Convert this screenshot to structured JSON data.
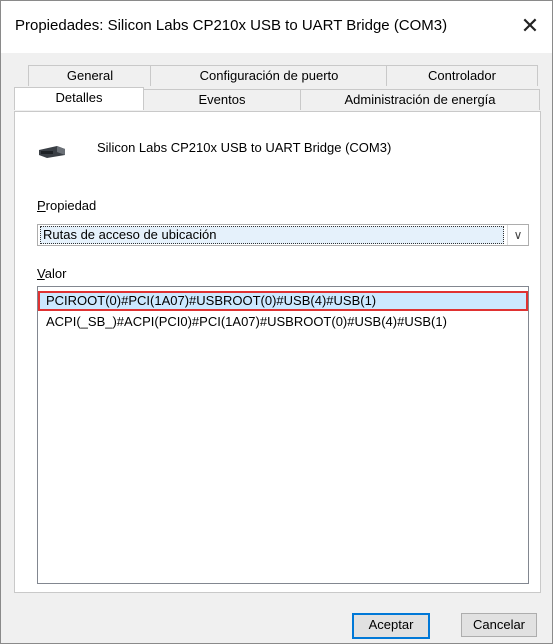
{
  "window": {
    "title": "Propiedades: Silicon Labs CP210x USB to UART Bridge (COM3)",
    "close_glyph": "✕"
  },
  "tabs_top": [
    {
      "label": "General"
    },
    {
      "label": "Configuración de puerto"
    },
    {
      "label": "Controlador"
    }
  ],
  "tabs_bottom": [
    {
      "label": "Detalles",
      "active": true
    },
    {
      "label": "Eventos"
    },
    {
      "label": "Administración de energía"
    }
  ],
  "device": {
    "icon": "usb-device-icon",
    "name": "Silicon Labs CP210x USB to UART Bridge (COM3)"
  },
  "property": {
    "label": "Propiedad",
    "access_key": "P",
    "label_rest": "ropiedad",
    "selected": "Rutas de acceso de ubicación"
  },
  "value": {
    "label": "Valor",
    "access_key": "V",
    "label_rest": "alor",
    "items": [
      "PCIROOT(0)#PCI(1A07)#USBROOT(0)#USB(4)#USB(1)",
      "ACPI(_SB_)#ACPI(PCI0)#PCI(1A07)#USBROOT(0)#USB(4)#USB(1)"
    ]
  },
  "buttons": {
    "ok": "Aceptar",
    "cancel": "Cancelar"
  }
}
